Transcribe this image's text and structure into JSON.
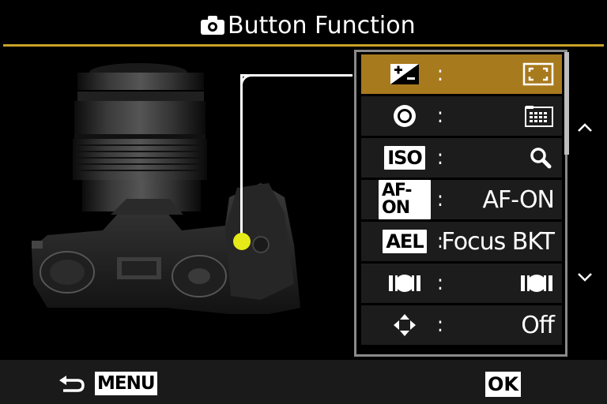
{
  "header": {
    "title": "Button Function",
    "accent_color": "#c9a227",
    "icon": "camera-icon"
  },
  "menu": {
    "selected_index": 0,
    "selected_color": "#a87a1e",
    "items": [
      {
        "button_icon": "exposure-compensation-icon",
        "separator": ":",
        "value_icon": "af-target-frame-icon",
        "value": ""
      },
      {
        "button_icon": "record-button-icon",
        "separator": ":",
        "value_icon": "af-area-grid-icon",
        "value": ""
      },
      {
        "button_icon": "iso-icon",
        "button_label": "ISO",
        "separator": ":",
        "value_icon": "magnify-icon",
        "value": ""
      },
      {
        "button_icon": "af-on-icon",
        "button_label": "AF-ON",
        "separator": ":",
        "value": "AF-ON"
      },
      {
        "button_icon": "ael-icon",
        "button_label": "AEL",
        "separator": ":",
        "value": "Focus BKT"
      },
      {
        "button_icon": "metering-icon",
        "separator": ":",
        "value_icon": "metering-icon",
        "value": ""
      },
      {
        "button_icon": "four-way-arrow-icon",
        "separator": ":",
        "value": "Off"
      }
    ]
  },
  "scroll": {
    "up_icon": "chevron-up-icon",
    "down_icon": "chevron-down-icon"
  },
  "footer": {
    "back_icon": "back-arrow-icon",
    "menu_label": "MENU",
    "ok_label": "OK"
  },
  "callout": {
    "dot_color": "#e6ea18"
  }
}
